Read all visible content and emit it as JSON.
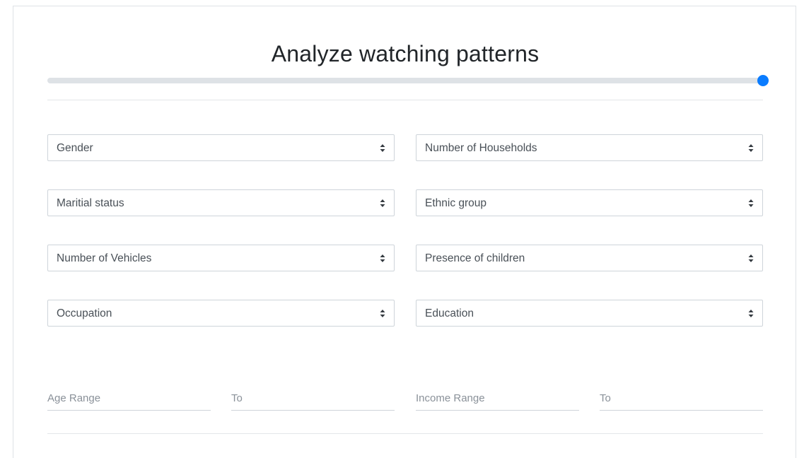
{
  "form": {
    "title": "Analyze watching patterns",
    "progress": 1.0,
    "selects": {
      "gender": "Gender",
      "households": "Number of Households",
      "marital": "Maritial status",
      "ethnic": "Ethnic group",
      "vehicles": "Number of Vehicles",
      "children": "Presence of children",
      "occupation": "Occupation",
      "education": "Education"
    },
    "ranges": {
      "age_from_placeholder": "Age Range",
      "age_to_placeholder": "To",
      "income_from_placeholder": "Income Range",
      "income_to_placeholder": "To"
    },
    "accent_color": "#0a7cff",
    "caret_icon": "sort-caret-icon"
  }
}
